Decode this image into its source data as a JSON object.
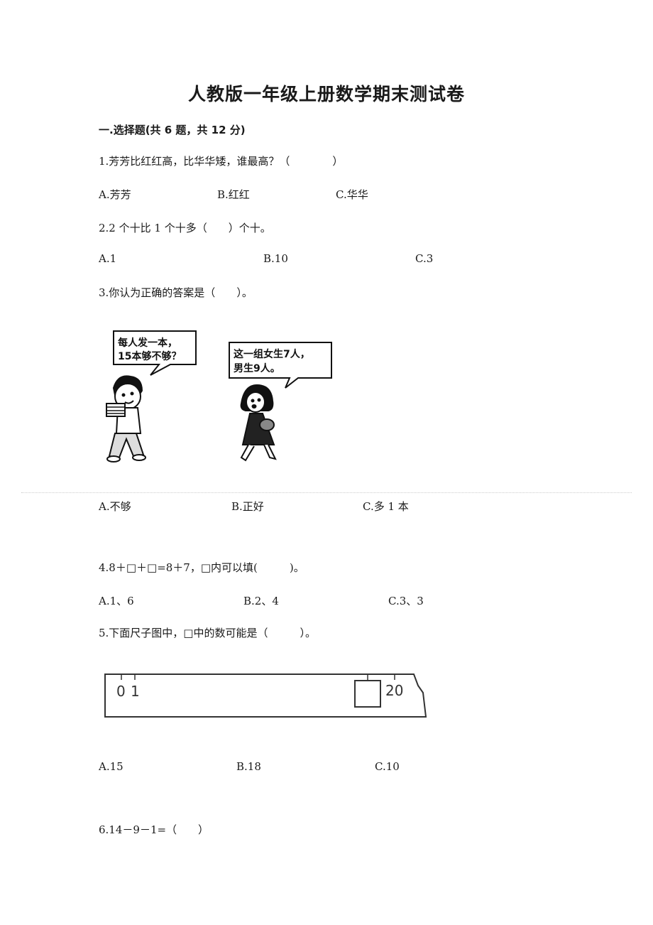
{
  "document": {
    "title": "人教版一年级上册数学期末测试卷",
    "section": "一.选择题(共 6 题，共 12 分)"
  },
  "questions": [
    {
      "stem": "1.芳芳比红红高，比华华矮，谁最高？（　　　　）",
      "options": [
        "A.芳芳",
        "B.红红",
        "C.华华"
      ]
    },
    {
      "stem": "2.2 个十比 1 个十多（　　）个十。",
      "options": [
        "A.1",
        "B.10",
        "C.3"
      ]
    },
    {
      "stem": "3.你认为正确的答案是（　　）。",
      "illustration": {
        "boy_bubble": [
          "每人发一本，",
          "15本够不够？"
        ],
        "girl_bubble": [
          "这一组女生7人，",
          "男生9人。"
        ]
      },
      "options": [
        "A.不够",
        "B.正好",
        "C.多 1 本"
      ]
    },
    {
      "stem": "4.8＋□＋□=8＋7，□内可以填(　　　)。",
      "options": [
        "A.1、6",
        "B.2、4",
        "C.3、3"
      ]
    },
    {
      "stem": "5.下面尺子图中，□中的数可能是（　　　）。",
      "ruler": {
        "labels": [
          "0",
          "1",
          "20"
        ]
      },
      "options": [
        "A.15",
        "B.18",
        "C.10"
      ]
    },
    {
      "stem": "6.14－9－1=（　　）"
    }
  ]
}
